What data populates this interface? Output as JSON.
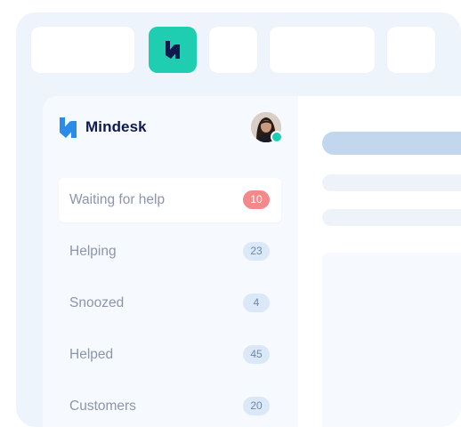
{
  "colors": {
    "accent": "#1fcdb0",
    "brand_dark": "#0f1b4c",
    "brand_blue": "#2a8ce8",
    "alert_badge": "#f3898a",
    "neutral_badge": "#dbe8f7",
    "frame_bg": "#eef4fb"
  },
  "top_bar": {
    "app_icon": "mindesk-logo-icon"
  },
  "brand": {
    "name": "Mindesk",
    "logo_icon": "mindesk-logo-icon"
  },
  "user": {
    "avatar": "user-avatar",
    "status": "online"
  },
  "nav": {
    "items": [
      {
        "label": "Waiting for help",
        "count": "10",
        "active": true
      },
      {
        "label": "Helping",
        "count": "23",
        "active": false
      },
      {
        "label": "Snoozed",
        "count": "4",
        "active": false
      },
      {
        "label": "Helped",
        "count": "45",
        "active": false
      },
      {
        "label": "Customers",
        "count": "20",
        "active": false
      }
    ]
  }
}
